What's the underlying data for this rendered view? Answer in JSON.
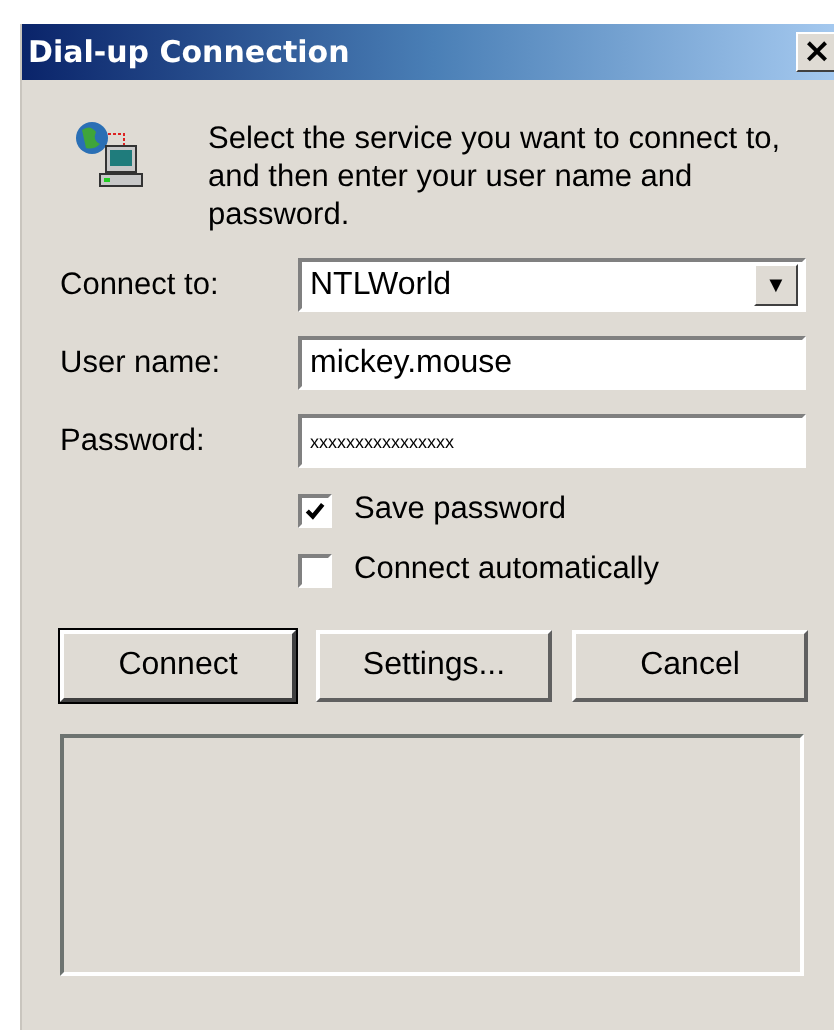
{
  "window": {
    "title": "Dial-up Connection",
    "close_label": "×"
  },
  "instructions": "Select the service you want to connect to, and then enter your user name and password.",
  "fields": [
    {
      "kind": "dropdown",
      "label": "Connect to:",
      "value": "NTLWorld",
      "caret": "▼"
    },
    {
      "kind": "text",
      "label": "User name:",
      "value": "mickey.mouse"
    },
    {
      "kind": "password",
      "label": "Password:",
      "value": "xxxxxxxxxxxxxxxx"
    }
  ],
  "options": [
    {
      "label": "Save password",
      "checked": true
    },
    {
      "label": "Connect automatically",
      "checked": false
    }
  ],
  "buttons": [
    {
      "label": "Connect",
      "default": true
    },
    {
      "label": "Settings...",
      "default": false
    },
    {
      "label": "Cancel",
      "default": false
    }
  ]
}
